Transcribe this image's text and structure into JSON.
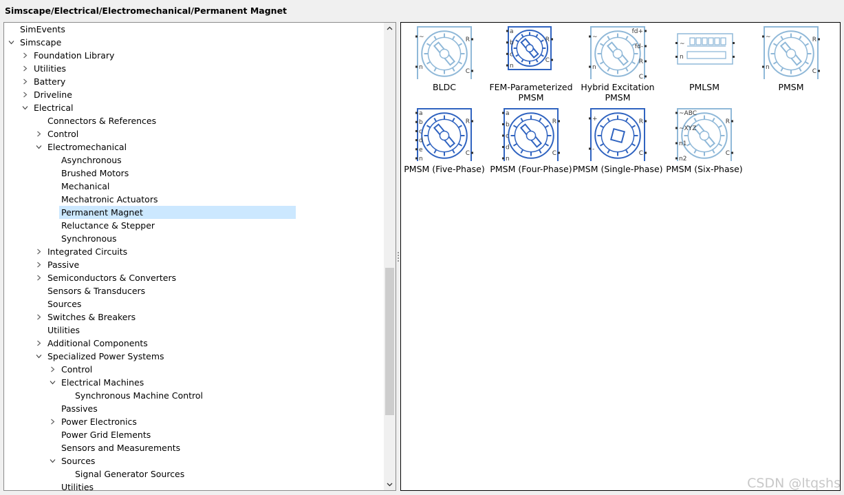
{
  "breadcrumb": "Simscape/Electrical/Electromechanical/Permanent Magnet",
  "tree": [
    {
      "label": "SimEvents",
      "depth": 0,
      "expander": "none"
    },
    {
      "label": "Simscape",
      "depth": 0,
      "expander": "open"
    },
    {
      "label": "Foundation Library",
      "depth": 1,
      "expander": "closed"
    },
    {
      "label": "Utilities",
      "depth": 1,
      "expander": "closed"
    },
    {
      "label": "Battery",
      "depth": 1,
      "expander": "closed"
    },
    {
      "label": "Driveline",
      "depth": 1,
      "expander": "closed"
    },
    {
      "label": "Electrical",
      "depth": 1,
      "expander": "open"
    },
    {
      "label": "Connectors & References",
      "depth": 2,
      "expander": "none"
    },
    {
      "label": "Control",
      "depth": 2,
      "expander": "closed"
    },
    {
      "label": "Electromechanical",
      "depth": 2,
      "expander": "open"
    },
    {
      "label": "Asynchronous",
      "depth": 3,
      "expander": "none"
    },
    {
      "label": "Brushed Motors",
      "depth": 3,
      "expander": "none"
    },
    {
      "label": "Mechanical",
      "depth": 3,
      "expander": "none"
    },
    {
      "label": "Mechatronic Actuators",
      "depth": 3,
      "expander": "none"
    },
    {
      "label": "Permanent Magnet",
      "depth": 3,
      "expander": "none",
      "selected": true
    },
    {
      "label": "Reluctance & Stepper",
      "depth": 3,
      "expander": "none"
    },
    {
      "label": "Synchronous",
      "depth": 3,
      "expander": "none"
    },
    {
      "label": "Integrated Circuits",
      "depth": 2,
      "expander": "closed"
    },
    {
      "label": "Passive",
      "depth": 2,
      "expander": "closed"
    },
    {
      "label": "Semiconductors & Converters",
      "depth": 2,
      "expander": "closed"
    },
    {
      "label": "Sensors & Transducers",
      "depth": 2,
      "expander": "none"
    },
    {
      "label": "Sources",
      "depth": 2,
      "expander": "none"
    },
    {
      "label": "Switches & Breakers",
      "depth": 2,
      "expander": "closed"
    },
    {
      "label": "Utilities",
      "depth": 2,
      "expander": "none"
    },
    {
      "label": "Additional Components",
      "depth": 2,
      "expander": "closed"
    },
    {
      "label": "Specialized Power Systems",
      "depth": 2,
      "expander": "open"
    },
    {
      "label": "Control",
      "depth": 3,
      "expander": "closed"
    },
    {
      "label": "Electrical Machines",
      "depth": 3,
      "expander": "open"
    },
    {
      "label": "Synchronous Machine Control",
      "depth": 4,
      "expander": "none"
    },
    {
      "label": "Passives",
      "depth": 3,
      "expander": "none"
    },
    {
      "label": "Power Electronics",
      "depth": 3,
      "expander": "closed"
    },
    {
      "label": "Power Grid Elements",
      "depth": 3,
      "expander": "none"
    },
    {
      "label": "Sensors and Measurements",
      "depth": 3,
      "expander": "none"
    },
    {
      "label": "Sources",
      "depth": 3,
      "expander": "open"
    },
    {
      "label": "Signal Generator Sources",
      "depth": 4,
      "expander": "none"
    },
    {
      "label": "Utilities",
      "depth": 3,
      "expander": "none"
    }
  ],
  "blocks": [
    {
      "name": "BLDC",
      "style": "light",
      "ports_left": [
        "~",
        "n"
      ],
      "ports_right": [
        "R",
        "C"
      ]
    },
    {
      "name": "FEM-Parameterized PMSM",
      "style": "dark",
      "ports_left": [
        "a",
        "b",
        "c",
        "n"
      ],
      "ports_right": [
        "R",
        "C"
      ]
    },
    {
      "name": "Hybrid Excitation PMSM",
      "style": "light",
      "ports_left": [
        "~",
        "n"
      ],
      "ports_right": [
        "fd+",
        "fd-",
        "R",
        "C"
      ]
    },
    {
      "name": "PMLSM",
      "style": "light",
      "ports_left": [
        "~",
        "n"
      ],
      "ports_right": []
    },
    {
      "name": "PMSM",
      "style": "light",
      "ports_left": [
        "~",
        "n"
      ],
      "ports_right": [
        "R",
        "C"
      ]
    },
    {
      "name": "PMSM (Five-Phase)",
      "style": "dark",
      "ports_left": [
        "a",
        "b",
        "c",
        "d",
        "e",
        "n"
      ],
      "ports_right": [
        "R",
        "C"
      ]
    },
    {
      "name": "PMSM (Four-Phase)",
      "style": "dark",
      "ports_left": [
        "a",
        "b",
        "c",
        "d",
        "n"
      ],
      "ports_right": [
        "R",
        "C"
      ]
    },
    {
      "name": "PMSM (Single-Phase)",
      "style": "dark",
      "ports_left": [
        "+",
        "-"
      ],
      "ports_right": [
        "R",
        "C"
      ]
    },
    {
      "name": "PMSM (Six-Phase)",
      "style": "light",
      "ports_left": [
        "~ABC",
        "~XYZ",
        "n1",
        "n2"
      ],
      "ports_right": [
        "R",
        "C"
      ]
    }
  ],
  "watermark": "CSDN @ltqshs",
  "colors": {
    "selection": "#cce8ff",
    "block_light": "#8fb8d8",
    "block_dark": "#2f63c0"
  }
}
